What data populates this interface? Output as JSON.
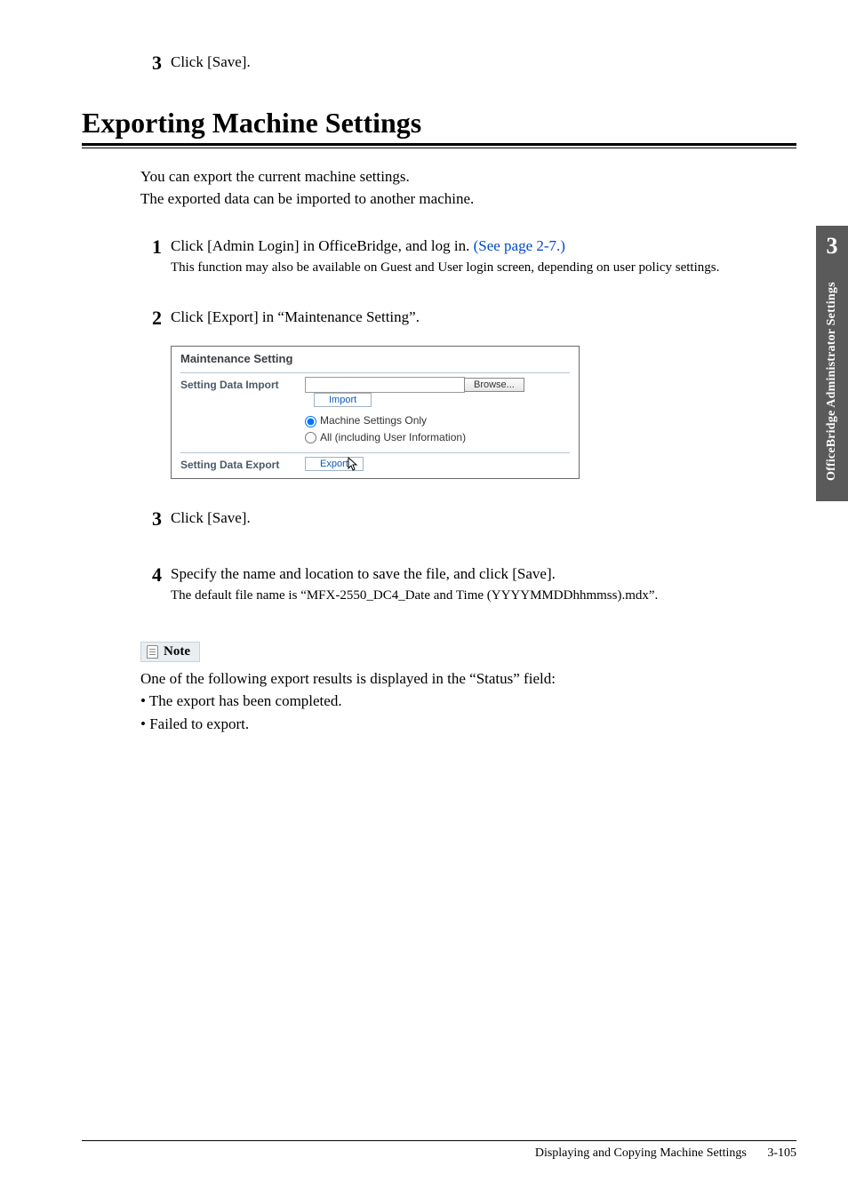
{
  "top_step": {
    "num": "3",
    "text": "Click [Save]."
  },
  "section_title": "Exporting Machine Settings",
  "intro_lines": [
    "You can export the current machine settings.",
    "The exported data can be imported to another machine."
  ],
  "steps": [
    {
      "num": "1",
      "text_prefix": "Click [Admin Login] in OfficeBridge, and log in. ",
      "link": "(See page 2-7.)",
      "sub": "This function may also be available on Guest and User login screen, depending on user policy settings."
    },
    {
      "num": "2",
      "text": "Click [Export] in “Maintenance Setting”."
    },
    {
      "num": "3",
      "text": " Click [Save]."
    },
    {
      "num": "4",
      "text": "Specify the name and location to save the file, and click [Save].",
      "sub": "The default file name is “MFX-2550_DC4_Date and Time (YYYYMMDDhhmmss).mdx”."
    }
  ],
  "screenshot": {
    "title": "Maintenance Setting",
    "import_label": "Setting Data Import",
    "browse": "Browse...",
    "import_btn": "Import",
    "radio1": "Machine Settings Only",
    "radio2": "All (including User Information)",
    "export_label": "Setting Data Export",
    "export_btn": "Export"
  },
  "note": {
    "label": "Note",
    "lead": "One of the following export results is displayed in the “Status” field:",
    "bullets": [
      "The export has been completed.",
      "Failed to export."
    ]
  },
  "sidebar": {
    "chapter_num": "3",
    "chapter_title": "OfficeBridge Administrator Settings"
  },
  "footer": {
    "title": "Displaying and Copying Machine Settings",
    "page": "3-105"
  }
}
